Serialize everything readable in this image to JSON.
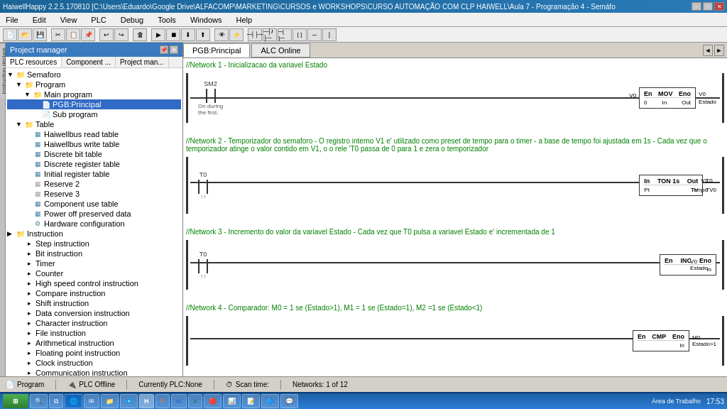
{
  "titlebar": {
    "title": "HaiwellHappy 2.2.5.170810 [C:\\Users\\Eduardo\\Google Drive\\ALFACOMP\\MARKETING\\CURSOS e WORKSHOPS\\CURSO AUTOMAÇÃO COM CLP HAIWELL\\Aula 7 - Programação 4 - Semáfo",
    "minimize": "−",
    "maximize": "□",
    "close": "✕"
  },
  "menubar": {
    "items": [
      "File",
      "Edit",
      "View",
      "PLC",
      "Debug",
      "Tools",
      "Windows",
      "Help"
    ]
  },
  "panel": {
    "title": "Project manager",
    "tabs": [
      "PLC resources",
      "Component ...",
      "Project man..."
    ],
    "tree": [
      {
        "label": "Semaforo",
        "level": 0,
        "type": "folder",
        "expand": "▼"
      },
      {
        "label": "Program",
        "level": 1,
        "type": "folder",
        "expand": "▼"
      },
      {
        "label": "Main program",
        "level": 2,
        "type": "folder",
        "expand": "▼"
      },
      {
        "label": "PGB:Principal",
        "level": 3,
        "type": "page",
        "selected": true
      },
      {
        "label": "Sub program",
        "level": 3,
        "type": "page"
      },
      {
        "label": "Table",
        "level": 1,
        "type": "folder",
        "expand": "▼"
      },
      {
        "label": "Haiwellbus read table",
        "level": 2,
        "type": "table"
      },
      {
        "label": "Haiwellbus write table",
        "level": 2,
        "type": "table"
      },
      {
        "label": "Discrete bit table",
        "level": 2,
        "type": "table"
      },
      {
        "label": "Discrete register table",
        "level": 2,
        "type": "table"
      },
      {
        "label": "Initial register table",
        "level": 2,
        "type": "table"
      },
      {
        "label": "Reserve 2",
        "level": 2,
        "type": "reserve"
      },
      {
        "label": "Reserve 3",
        "level": 2,
        "type": "reserve"
      },
      {
        "label": "Component use table",
        "level": 2,
        "type": "table"
      },
      {
        "label": "Power off preserved data",
        "level": 2,
        "type": "table"
      },
      {
        "label": "Hardware configuration",
        "level": 2,
        "type": "config"
      },
      {
        "label": "Instruction",
        "level": 0,
        "type": "folder",
        "expand": "▶"
      },
      {
        "label": "Step instruction",
        "level": 1,
        "type": "item"
      },
      {
        "label": "Bit instruction",
        "level": 1,
        "type": "item"
      },
      {
        "label": "Timer",
        "level": 1,
        "type": "item"
      },
      {
        "label": "Counter",
        "level": 1,
        "type": "item"
      },
      {
        "label": "High speed control instruction",
        "level": 1,
        "type": "item"
      },
      {
        "label": "Compare instruction",
        "level": 1,
        "type": "item"
      },
      {
        "label": "Shift instruction",
        "level": 1,
        "type": "item"
      },
      {
        "label": "Data conversion instruction",
        "level": 1,
        "type": "item"
      },
      {
        "label": "Character instruction",
        "level": 1,
        "type": "item"
      },
      {
        "label": "File instruction",
        "level": 1,
        "type": "item"
      },
      {
        "label": "Arithmetical instruction",
        "level": 1,
        "type": "item"
      },
      {
        "label": "Floating point instruction",
        "level": 1,
        "type": "item"
      },
      {
        "label": "Clock instruction",
        "level": 1,
        "type": "item"
      },
      {
        "label": "Communication instruction",
        "level": 1,
        "type": "item"
      }
    ]
  },
  "content": {
    "tabs": [
      "PGB:Principal",
      "ALC Online"
    ],
    "networks": [
      {
        "id": "1",
        "comment": "//Network 1 - Inicializacao da variavel Estado",
        "elements": "SM2 contact, MOV block: En/Eno, 0→In, Out→V0/Estado"
      },
      {
        "id": "2",
        "comment": "//Network 2 - Temporizador do semaforo - O registro interno V1 e' utilizado como preset de tempo para o timer - a base de tempo foi ajustada em 1s - Cada vez que o temporizador atinge o valor contido em V1, o o rele 'T0 passa de 0 para 1 e zera o temporizador",
        "elements": "T0 contact, TON 1s block: In/Out→T0, Pt/TV→V1 Tempo/TV0"
      },
      {
        "id": "3",
        "comment": "//Network 3 - Incremento do valor da variavel Estado - Cada vez que T0 pulsa a variavel Estado e' incrementada de 1",
        "elements": "T0 contact, INC block: En/Eno, V0 Estado→In"
      },
      {
        "id": "4",
        "comment": "//Network 4 - Comparador: M0 = 1 se (Estado>1), M1 = 1 se (Estado=1), M2 =1 se (Estado<1)",
        "elements": "CMP block: En/Eno, V0→In, Estado>1→M0"
      }
    ]
  },
  "statusbar": {
    "items": [
      "Program",
      "PLC Offline",
      "Currently PLC:None",
      "Scan time:",
      "Networks: 1 of 12"
    ]
  },
  "taskbar": {
    "start_label": "⊞",
    "clock": "17:53",
    "area_label": "Área de Trabalho",
    "apps": [
      "❖",
      "🗂",
      "IE",
      "✉",
      "📁",
      "🔵",
      "H",
      "P",
      "W",
      "E",
      "🔴",
      "📊",
      "📝",
      "🔷",
      "💬"
    ]
  }
}
